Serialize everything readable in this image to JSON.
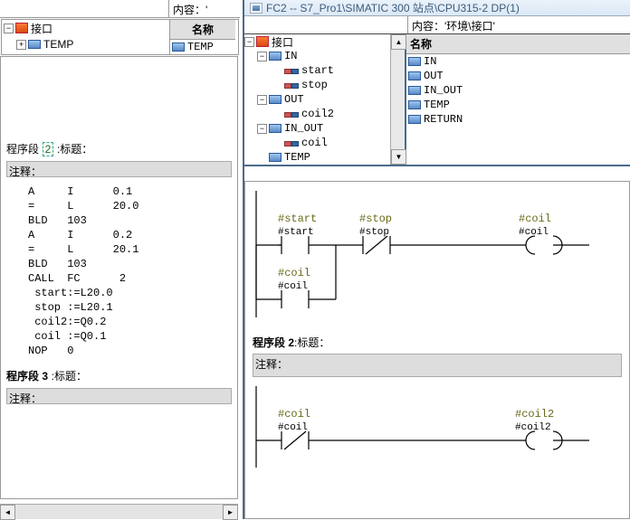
{
  "left": {
    "header_content": "内容：'",
    "if_root": "接口",
    "if_temp": "TEMP",
    "col_name": "名称",
    "col_val": "TEMP",
    "seg2_label": "程序段",
    "seg2_num": "2",
    "seg2_title": ":标题：",
    "comment": "注释：",
    "stl_lines": "A     I      0.1\n=     L      20.0\nBLD   103\nA     I      0.2\n=     L      20.1\nBLD   103\nCALL  FC      2\n start:=L20.0\n stop :=L20.1\n coil2:=Q0.2\n coil :=Q0.1\nNOP   0",
    "seg3_label": "程序段 3",
    "seg3_title": ":标题："
  },
  "right": {
    "title": "FC2 -- S7_Pro1\\SIMATIC 300 站点\\CPU315-2 DP(1)",
    "header_content": "内容：'环境\\接口'",
    "tree": {
      "root": "接口",
      "in": "IN",
      "in_items": [
        "start",
        "stop"
      ],
      "out": "OUT",
      "out_items": [
        "coil2"
      ],
      "inout": "IN_OUT",
      "inout_items": [
        "coil"
      ],
      "temp": "TEMP"
    },
    "col_name": "名称",
    "col_items": [
      "IN",
      "OUT",
      "IN_OUT",
      "TEMP",
      "RETURN"
    ],
    "net1": {
      "start_tag": "#start",
      "start_addr": "#start",
      "stop_tag": "#stop",
      "stop_addr": "#stop",
      "coil_tag": "#coil",
      "coil_addr": "#coil",
      "branch_tag": "#coil",
      "branch_addr": "#coil"
    },
    "seg2_label": "程序段 2",
    "seg2_title": ":标题：",
    "comment": "注释：",
    "net2": {
      "coil_tag": "#coil",
      "coil_addr": "#coil",
      "coil2_tag": "#coil2",
      "coil2_addr": "#coil2"
    }
  }
}
